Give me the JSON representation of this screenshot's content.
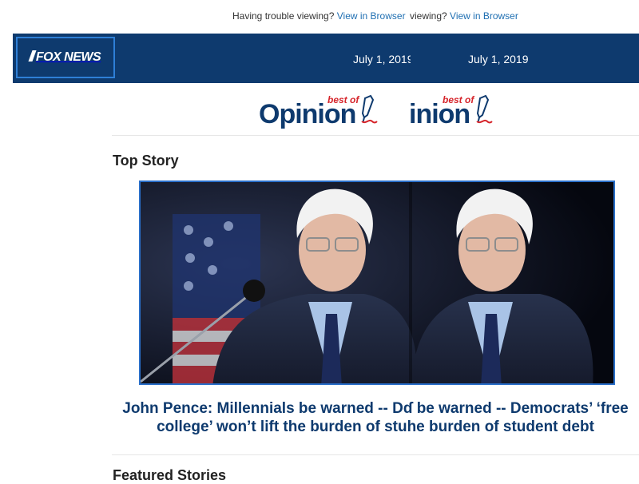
{
  "topbar": {
    "line1_prefix": "Having trouble viewing? ",
    "line1_link": "View in Browser",
    "line2_prefix": "viewing? ",
    "line2_link": "View in Browser"
  },
  "header": {
    "logo": "FOX NEWS",
    "date_1": "July 1, 2019",
    "date_2": "July 1, 2019",
    "background": "#0e3a6e"
  },
  "banner": {
    "best_of_1": "best of",
    "opinion_1": "Opinion",
    "best_of_2": "best of",
    "opinion_2": "inion"
  },
  "top_story": {
    "section_title": "Top Story",
    "headline": "John Pence: Millennials be warned -- Dɗ be warned -- Democrats’ ‘free college’ won’t lift the burden of stuhe burden of student debt"
  },
  "featured": {
    "section_title": "Featured Stories"
  },
  "colors": {
    "accent": "#2a6fc9",
    "brand_navy": "#0e3a6e",
    "opinion_red": "#d6252b"
  }
}
